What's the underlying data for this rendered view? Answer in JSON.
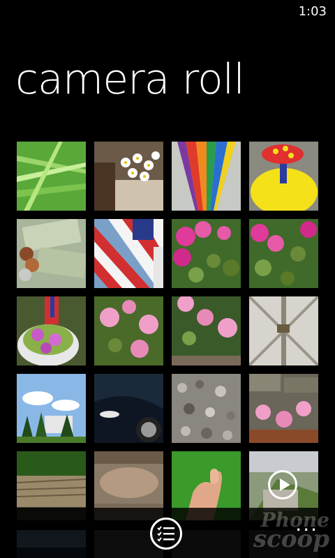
{
  "status_bar": {
    "time": "1:03"
  },
  "page": {
    "title": "camera roll"
  },
  "app_bar": {
    "button_icon": "list-icon",
    "more_icon": "more-dots-icon",
    "more_text": "...",
    "watermark_line1": "Phone",
    "watermark_line2": "scoop"
  },
  "colors": {
    "background": "#000000",
    "text": "#ffffff"
  }
}
